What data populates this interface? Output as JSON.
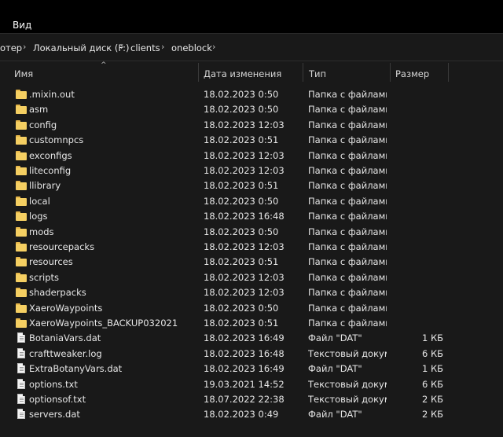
{
  "menu": {
    "view": "Вид"
  },
  "breadcrumb": [
    {
      "label": "отер"
    },
    {
      "label": "Локальный диск (F:)"
    },
    {
      "label": "clients"
    },
    {
      "label": "oneblock"
    }
  ],
  "columns": {
    "name": "Имя",
    "date": "Дата изменения",
    "type": "Тип",
    "size": "Размер"
  },
  "files": [
    {
      "name": ".mixin.out",
      "date": "18.02.2023 0:50",
      "type": "Папка с файлами",
      "size": "",
      "kind": "folder"
    },
    {
      "name": "asm",
      "date": "18.02.2023 0:50",
      "type": "Папка с файлами",
      "size": "",
      "kind": "folder"
    },
    {
      "name": "config",
      "date": "18.02.2023 12:03",
      "type": "Папка с файлами",
      "size": "",
      "kind": "folder"
    },
    {
      "name": "customnpcs",
      "date": "18.02.2023 0:51",
      "type": "Папка с файлами",
      "size": "",
      "kind": "folder"
    },
    {
      "name": "exconfigs",
      "date": "18.02.2023 12:03",
      "type": "Папка с файлами",
      "size": "",
      "kind": "folder"
    },
    {
      "name": "liteconfig",
      "date": "18.02.2023 12:03",
      "type": "Папка с файлами",
      "size": "",
      "kind": "folder"
    },
    {
      "name": "llibrary",
      "date": "18.02.2023 0:51",
      "type": "Папка с файлами",
      "size": "",
      "kind": "folder"
    },
    {
      "name": "local",
      "date": "18.02.2023 0:50",
      "type": "Папка с файлами",
      "size": "",
      "kind": "folder"
    },
    {
      "name": "logs",
      "date": "18.02.2023 16:48",
      "type": "Папка с файлами",
      "size": "",
      "kind": "folder"
    },
    {
      "name": "mods",
      "date": "18.02.2023 0:50",
      "type": "Папка с файлами",
      "size": "",
      "kind": "folder"
    },
    {
      "name": "resourcepacks",
      "date": "18.02.2023 12:03",
      "type": "Папка с файлами",
      "size": "",
      "kind": "folder"
    },
    {
      "name": "resources",
      "date": "18.02.2023 0:51",
      "type": "Папка с файлами",
      "size": "",
      "kind": "folder"
    },
    {
      "name": "scripts",
      "date": "18.02.2023 12:03",
      "type": "Папка с файлами",
      "size": "",
      "kind": "folder"
    },
    {
      "name": "shaderpacks",
      "date": "18.02.2023 12:03",
      "type": "Папка с файлами",
      "size": "",
      "kind": "folder"
    },
    {
      "name": "XaeroWaypoints",
      "date": "18.02.2023 0:50",
      "type": "Папка с файлами",
      "size": "",
      "kind": "folder"
    },
    {
      "name": "XaeroWaypoints_BACKUP032021",
      "date": "18.02.2023 0:51",
      "type": "Папка с файлами",
      "size": "",
      "kind": "folder"
    },
    {
      "name": "BotaniaVars.dat",
      "date": "18.02.2023 16:49",
      "type": "Файл \"DAT\"",
      "size": "1 КБ",
      "kind": "file"
    },
    {
      "name": "crafttweaker.log",
      "date": "18.02.2023 16:48",
      "type": "Текстовый докум...",
      "size": "6 КБ",
      "kind": "file"
    },
    {
      "name": "ExtraBotanyVars.dat",
      "date": "18.02.2023 16:49",
      "type": "Файл \"DAT\"",
      "size": "1 КБ",
      "kind": "file"
    },
    {
      "name": "options.txt",
      "date": "19.03.2021 14:52",
      "type": "Текстовый докум...",
      "size": "6 КБ",
      "kind": "file"
    },
    {
      "name": "optionsof.txt",
      "date": "18.07.2022 22:38",
      "type": "Текстовый докум...",
      "size": "2 КБ",
      "kind": "file"
    },
    {
      "name": "servers.dat",
      "date": "18.02.2023 0:49",
      "type": "Файл \"DAT\"",
      "size": "2 КБ",
      "kind": "file"
    }
  ]
}
